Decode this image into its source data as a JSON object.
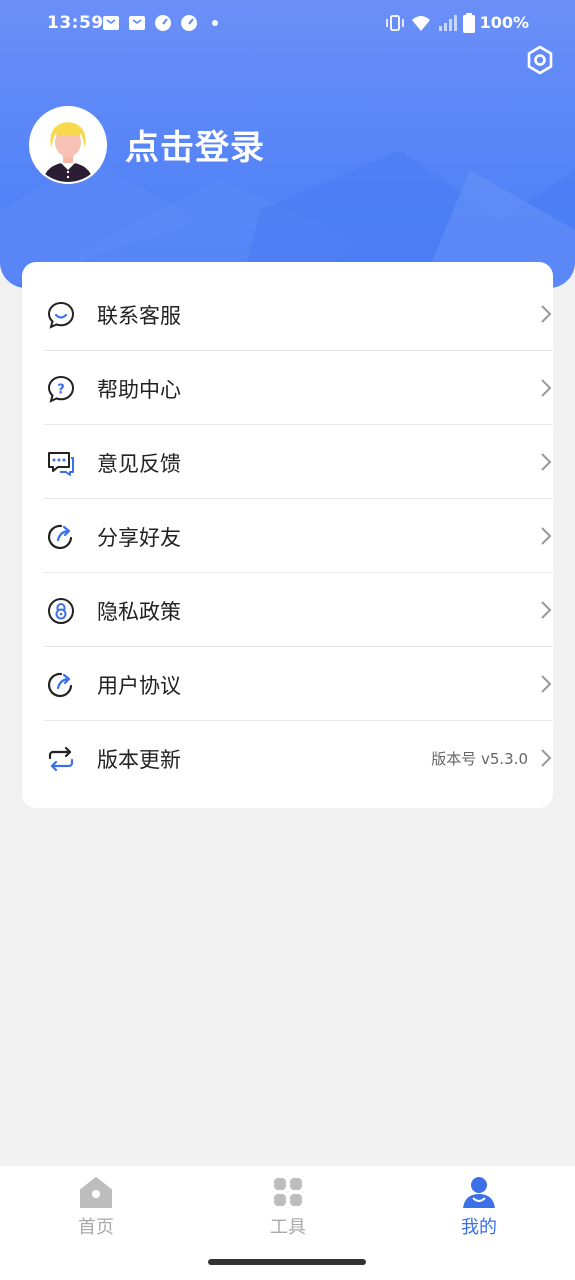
{
  "status_bar": {
    "time": "13:59",
    "battery": "100%",
    "left_icons": [
      "mail-icon",
      "mail-icon",
      "speedometer-icon",
      "speedometer-icon",
      "dot-icon"
    ],
    "right_icons": [
      "vibrate-icon",
      "wifi-icon",
      "signal-icon",
      "battery-icon"
    ]
  },
  "header": {
    "login_text": "点击登录",
    "settings_icon": "settings-icon",
    "gradient_colors": [
      "#6b8ff7",
      "#4c7ef5"
    ]
  },
  "menu": {
    "items": [
      {
        "label": "联系客服",
        "icon": "chat-bubble-icon",
        "extra": ""
      },
      {
        "label": "帮助中心",
        "icon": "help-question-icon",
        "extra": ""
      },
      {
        "label": "意见反馈",
        "icon": "feedback-icon",
        "extra": ""
      },
      {
        "label": "分享好友",
        "icon": "share-icon",
        "extra": ""
      },
      {
        "label": "隐私政策",
        "icon": "privacy-lock-icon",
        "extra": ""
      },
      {
        "label": "用户协议",
        "icon": "agreement-icon",
        "extra": ""
      },
      {
        "label": "版本更新",
        "icon": "update-refresh-icon",
        "extra": "版本号 v5.3.0"
      }
    ]
  },
  "tabbar": {
    "tabs": [
      {
        "label": "首页",
        "icon": "home-icon",
        "active": false
      },
      {
        "label": "工具",
        "icon": "grid-icon",
        "active": false
      },
      {
        "label": "我的",
        "icon": "user-icon",
        "active": true
      }
    ],
    "active_color": "#3b70e8",
    "inactive_color": "#aaaaaa"
  }
}
